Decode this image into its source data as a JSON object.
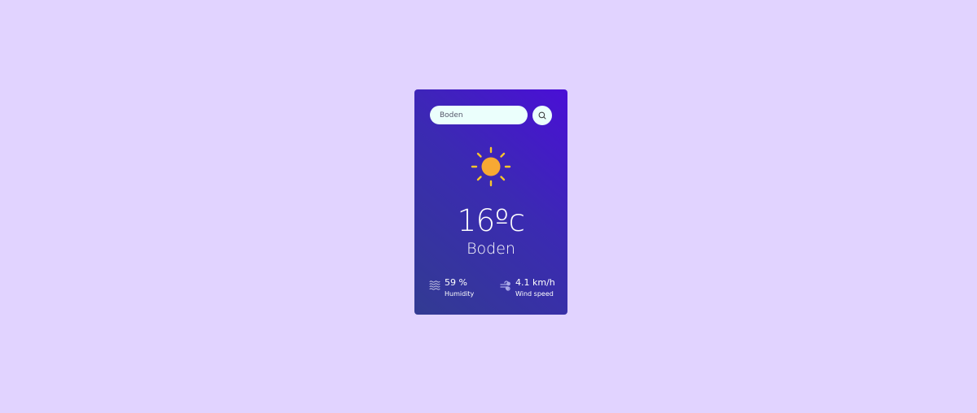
{
  "search": {
    "value": "Boden",
    "button_icon": "search-icon"
  },
  "weather": {
    "icon": "sun-icon",
    "temperature": "16ºc",
    "city": "Boden"
  },
  "details": {
    "humidity": {
      "icon": "humidity-waves-icon",
      "value": "59 %",
      "label": "Humidity"
    },
    "wind": {
      "icon": "wind-icon",
      "value": "4.1 km/h",
      "label": "Wind speed"
    }
  },
  "colors": {
    "page_background": "#e1d3ff",
    "card_gradient_top": "#4a0fd6",
    "card_gradient_bottom": "#323b92",
    "input_background": "#ebfffc",
    "sun": "#f7a933",
    "sun_rays": "#f7c52d"
  }
}
